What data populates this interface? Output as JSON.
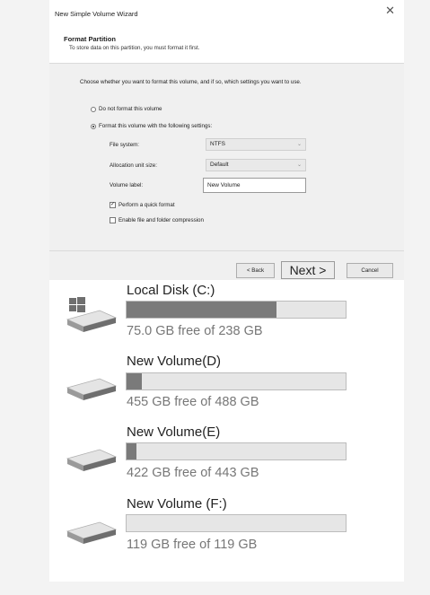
{
  "wizard": {
    "title": "New Simple Volume Wizard",
    "close_glyph": "✕",
    "heading": "Format Partition",
    "subheading": "To store data on this partition, you must format it first.",
    "prompt": "Choose whether you want to format this volume, and if so, which settings you want to use.",
    "options": {
      "no_format_label": "Do not format this volume",
      "format_label": "Format this volume with the following settings:",
      "selected": "format"
    },
    "fields": {
      "file_system_label": "File system:",
      "file_system_value": "NTFS",
      "alloc_label": "Allocation unit size:",
      "alloc_value": "Default",
      "volume_label_label": "Volume label:",
      "volume_label_value": "New Volume"
    },
    "checks": {
      "quick_format_label": "Perform a quick format",
      "quick_format_checked": true,
      "compression_label": "Enable file and folder compression",
      "compression_checked": false
    },
    "buttons": {
      "back": "< Back",
      "next": "Next >",
      "cancel": "Cancel"
    },
    "chevron_glyph": "⌄",
    "check_glyph": "✓"
  },
  "drives": [
    {
      "name": "Local Disk (C:)",
      "free_text": "75.0 GB free of 238 GB",
      "used_fraction": 0.685,
      "icon": "windows-drive-icon"
    },
    {
      "name": "New Volume(D)",
      "free_text": "455 GB free of 488 GB",
      "used_fraction": 0.068,
      "icon": "drive-icon"
    },
    {
      "name": "New Volume(E)",
      "free_text": "422 GB free of 443 GB",
      "used_fraction": 0.047,
      "icon": "drive-icon"
    },
    {
      "name": "New Volume (F:)",
      "free_text": "119 GB free of 119 GB",
      "used_fraction": 0.0,
      "icon": "drive-icon"
    }
  ],
  "colors": {
    "bar_fill": "#7a7a7a",
    "bar_track": "#e6e6e6"
  }
}
